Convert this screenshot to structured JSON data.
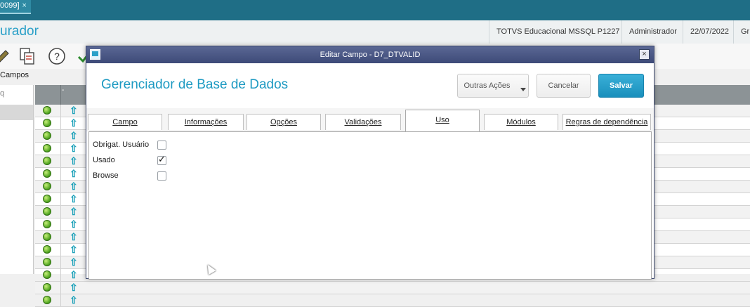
{
  "app_tab": {
    "label": "0099]",
    "close": "×"
  },
  "app_title": "urador",
  "status": {
    "database": "TOTVS Educacional MSSQL P1227",
    "user": "Administrador",
    "date": "22/07/2022",
    "group": "Gr"
  },
  "breadcrumb": "Campos",
  "left_panel": {
    "search_hint": "q"
  },
  "grid": {
    "header_mark": "-",
    "row_count": 16,
    "status_color": "#4aa11c",
    "arrow_glyph": "⇧"
  },
  "dialog": {
    "title": "Editar Campo - D7_DTVALID",
    "close": "×",
    "heading": "Gerenciador de Base de Dados",
    "buttons": {
      "more": "Outras Ações",
      "cancel": "Cancelar",
      "save": "Salvar"
    },
    "tabs": [
      {
        "label": "Campo"
      },
      {
        "label": "Informações"
      },
      {
        "label": "Opções"
      },
      {
        "label": "Validações"
      },
      {
        "label": "Uso"
      },
      {
        "label": "Módulos"
      },
      {
        "label": "Regras de dependência"
      }
    ],
    "active_tab": "Uso",
    "fields": [
      {
        "label": "Obrigat. Usuário",
        "checked": false
      },
      {
        "label": "Usado",
        "checked": true
      },
      {
        "label": "Browse",
        "checked": false
      }
    ]
  },
  "colors": {
    "accent": "#1d9ac2",
    "tabstrip": "#1f6e86",
    "dialog_titlebar": "#3d4a78",
    "primary_button": "#198fbc"
  }
}
